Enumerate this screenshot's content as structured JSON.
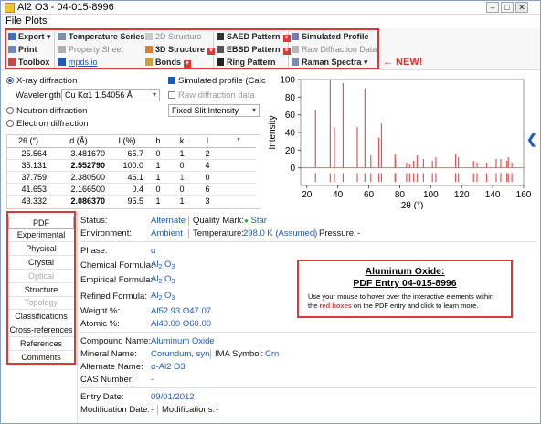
{
  "window": {
    "title": "Al2 O3 - 04-015-8996"
  },
  "menu": {
    "items": [
      "File",
      "Plots"
    ]
  },
  "ribbon": {
    "export": "Export",
    "print": "Print",
    "toolbox": "Toolbox",
    "temperature_series": "Temperature Series",
    "property_sheet": "Property Sheet",
    "mpds": "mpds.io",
    "structure_2d": "2D Structure",
    "structure_3d": "3D Structure",
    "bonds": "Bonds",
    "saed": "SAED Pattern",
    "ebsd": "EBSD Pattern",
    "ring": "Ring Pattern",
    "simulated_profile": "Simulated Profile",
    "raw_diffraction": "Raw Diffraction Data",
    "raman": "Raman Spectra",
    "new_label": "← NEW!"
  },
  "diffraction": {
    "xray": "X-ray diffraction",
    "wavelength_label": "Wavelength:",
    "wavelength_value": "Cu Kα1 1.54056 Å",
    "neutron": "Neutron diffraction",
    "electron": "Electron diffraction",
    "simulated_profile": "Simulated profile (Calc)",
    "raw_data": "Raw diffraction data",
    "slit": "Fixed Slit Intensity"
  },
  "table": {
    "headers": [
      "2θ (°)",
      "d (Å)",
      "I (%)",
      "h",
      "k",
      "l",
      "*"
    ],
    "rows": [
      [
        "25.564",
        "3.481670",
        "65.7",
        "0",
        "1",
        "2",
        ""
      ],
      [
        "35.131",
        "2.552790",
        "100.0",
        "1",
        "0",
        "4",
        ""
      ],
      [
        "37.759",
        "2.380500",
        "46.1",
        "1",
        "1",
        "0",
        ""
      ],
      [
        "41.653",
        "2.166500",
        "0.4",
        "0",
        "0",
        "6",
        ""
      ],
      [
        "43.332",
        "2.086370",
        "95.5",
        "1",
        "1",
        "3",
        ""
      ]
    ],
    "bold_rows": [
      1,
      4
    ]
  },
  "chart_data": {
    "type": "bar",
    "title": "",
    "xlabel": "2θ (°)",
    "ylabel": "Intensity",
    "xlim": [
      16,
      160
    ],
    "ylim": [
      -20,
      100
    ],
    "xticks": [
      "20",
      "40",
      "60",
      "80",
      "100",
      "120",
      "140",
      "160"
    ],
    "yticks": [
      "100",
      "80",
      "60",
      "40",
      "20",
      "0"
    ],
    "x": [
      25.6,
      35.1,
      37.8,
      43.4,
      52.6,
      57.5,
      61.3,
      66.5,
      68.2,
      76.9,
      77.2,
      84.4,
      86.4,
      89.0,
      91.2,
      95.3,
      101.1,
      103.3,
      116.1,
      117.9,
      127.7,
      129.9,
      136.1,
      142.3,
      145.2,
      149.2,
      150.1,
      152.4
    ],
    "values": [
      66,
      100,
      46,
      96,
      46,
      90,
      14,
      34,
      50,
      16,
      10,
      6,
      4,
      8,
      14,
      10,
      8,
      12,
      16,
      12,
      8,
      6,
      6,
      10,
      10,
      8,
      12,
      6
    ]
  },
  "tabs": [
    "PDF",
    "Experimental",
    "Physical",
    "Crystal",
    "Optical",
    "Structure",
    "Topology",
    "Classifications",
    "Cross-references",
    "References",
    "Comments"
  ],
  "status": {
    "status_label": "Status:",
    "status_value": "Alternate",
    "quality_label": "Quality Mark:",
    "quality_value": "Star",
    "env_label": "Environment:",
    "env_value": "Ambient",
    "temp_label": "Temperature:",
    "temp_value": "298.0 K (Assumed)",
    "pressure_label": "Pressure:",
    "pressure_value": "-"
  },
  "formula": {
    "phase_label": "Phase:",
    "phase_value": "α",
    "chem_label": "Chemical Formula:",
    "emp_label": "Empirical Formula:",
    "ref_label": "Refined Formula:",
    "al": "Al",
    "two": "2",
    "o": " O",
    "three": "3",
    "weight_label": "Weight %:",
    "weight_value": "Al52.93 O47.07",
    "atomic_label": "Atomic %:",
    "atomic_value": "Al40.00 O60.00"
  },
  "compound": {
    "name_label": "Compound Name:",
    "name_value": "Aluminum Oxide",
    "mineral_label": "Mineral Name:",
    "mineral_value": "Corundum, syn",
    "ima_label": "IMA Symbol:",
    "ima_value": "Crn",
    "alt_label": "Alternate Name:",
    "alt_value": "α-Al2 O3",
    "cas_label": "CAS Number:",
    "cas_value": "-"
  },
  "dates": {
    "entry_label": "Entry Date:",
    "entry_value": "09/01/2012",
    "mod_label": "Modification Date:",
    "mod_value": "-",
    "mods_label": "Modifications:",
    "mods_value": "-"
  },
  "info": {
    "title": "Aluminum Oxide:",
    "subtitle": "PDF Entry 04-015-8996",
    "text_a": "Use your mouse to hover over the interactive elements within the ",
    "text_b": "red boxes",
    "text_c": " on the PDF entry and click to learn more."
  },
  "colors": {
    "accent": "#d83a3a",
    "link": "#1e5bb8"
  }
}
